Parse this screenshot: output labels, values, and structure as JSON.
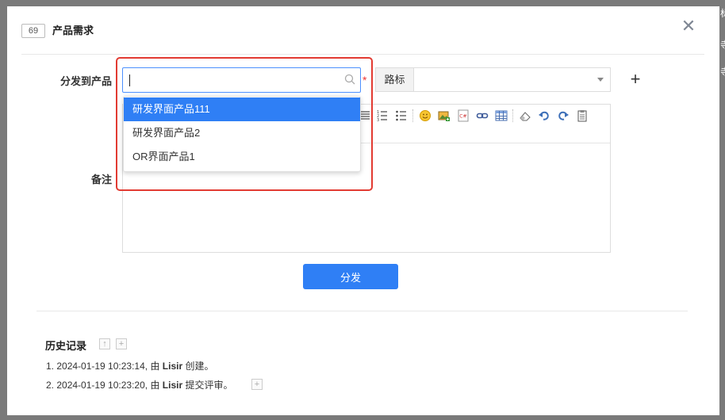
{
  "modal": {
    "id": "69",
    "title": "产品需求",
    "close_symbol": "✕"
  },
  "form": {
    "product_label": "分发到产品",
    "product_required_mark": "*",
    "product_input_value": "",
    "roadmap_label": "路标",
    "add_symbol": "+",
    "remark_label": "备注"
  },
  "dropdown": {
    "options": [
      "研发界面产品111",
      "研发界面产品2",
      "OR界面产品1"
    ],
    "selected_index": 0
  },
  "submit_label": "分发",
  "history": {
    "title": "历史记录",
    "items": [
      {
        "prefix": "1. 2024-01-19 10:23:14, 由 ",
        "user": "Lisir",
        "suffix": " 创建。"
      },
      {
        "prefix": "2. 2024-01-19 10:23:20, 由 ",
        "user": "Lisir",
        "suffix": " 提交评审。"
      }
    ]
  },
  "icons": {
    "search": "search-icon",
    "close": "close-icon",
    "dropdown": "chevron-down-icon"
  },
  "colors": {
    "primary": "#2f7ff5",
    "highlight": "#e23b32",
    "required": "#e33333"
  }
}
